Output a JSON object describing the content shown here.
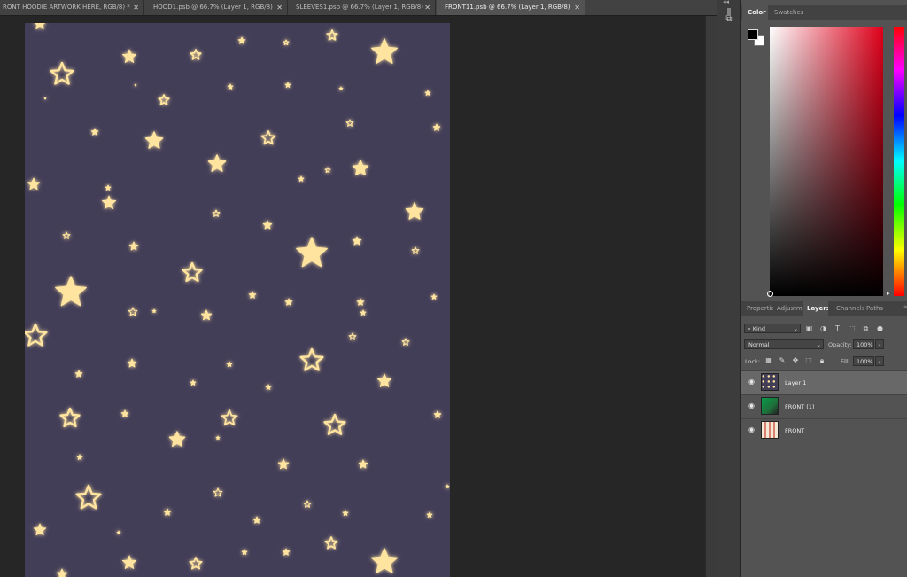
{
  "tabs": [
    {
      "label": "RONT HOODIE ARTWORK HERE, RGB/8) *",
      "active": false
    },
    {
      "label": "HOOD1.psb @ 66.7% (Layer 1, RGB/8)",
      "active": false
    },
    {
      "label": "SLEEVES1.psb @ 66.7% (Layer 1, RGB/8)",
      "active": false
    },
    {
      "label": "FRONT11.psb @ 66.7% (Layer 1, RGB/8)",
      "active": true
    }
  ],
  "tab_close_glyph": "✕",
  "canvas": {
    "background": "#433e58",
    "star_color": "#ffe4a0",
    "glow_color": "#ffc860"
  },
  "color_panel": {
    "tabs": {
      "color": "Color",
      "swatches": "Swatches"
    },
    "foreground": "#000000",
    "background": "#ffffff",
    "hue": "#e0001a"
  },
  "layers_panel": {
    "tabs": {
      "properties": "Propertie",
      "adjustments": "Adjustm",
      "layers": "Layers",
      "channels": "Channels",
      "paths": "Paths"
    },
    "filter_kind": "Kind",
    "blend_mode": "Normal",
    "opacity_label": "Opacity:",
    "opacity_value": "100%",
    "lock_label": "Lock:",
    "fill_label": "Fill:",
    "fill_value": "100%",
    "layers": [
      {
        "name": "Layer 1",
        "selected": true,
        "visible": true
      },
      {
        "name": "FRONT (1)",
        "selected": false,
        "visible": true
      },
      {
        "name": "FRONT",
        "selected": false,
        "visible": true
      }
    ]
  }
}
